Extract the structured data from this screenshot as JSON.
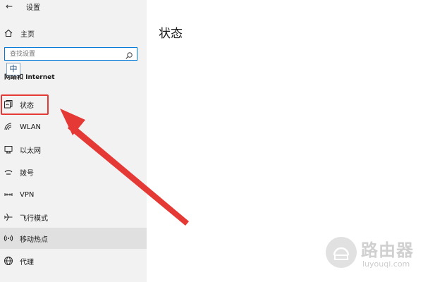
{
  "window": {
    "title": "设置",
    "back_glyph": "←"
  },
  "sidebar": {
    "home_label": "主页",
    "search_placeholder": "查找设置",
    "section_title": "网络和 Internet",
    "ime_indicator": "中",
    "items": [
      {
        "label": "状态",
        "icon": "status-icon",
        "selected": true
      },
      {
        "label": "WLAN",
        "icon": "wifi-icon"
      },
      {
        "label": "以太网",
        "icon": "ethernet-icon"
      },
      {
        "label": "拨号",
        "icon": "dialup-icon"
      },
      {
        "label": "VPN",
        "icon": "vpn-icon"
      },
      {
        "label": "飞行模式",
        "icon": "airplane-icon"
      },
      {
        "label": "移动热点",
        "icon": "hotspot-icon",
        "hovered": true
      },
      {
        "label": "代理",
        "icon": "proxy-globe-icon"
      }
    ]
  },
  "main": {
    "page_title": "状态"
  },
  "annotation": {
    "highlight_color": "#e53935",
    "arrow_color": "#e53935"
  },
  "watermark": {
    "main": "路由器",
    "sub": "luyouqi.com"
  },
  "colors": {
    "accent": "#0078d7",
    "sidebar_bg": "#f2f2f2",
    "hover_bg": "#e0e0e0"
  }
}
